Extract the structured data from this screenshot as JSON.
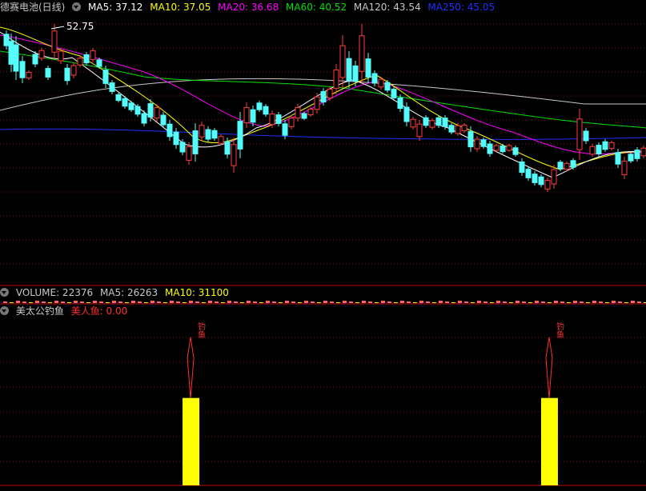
{
  "colors": {
    "bg": "#000000",
    "up": "#ff3c3c",
    "down": "#54fcfc",
    "ma5": "#ffffff",
    "ma10": "#ffff00",
    "ma20": "#ff00ff",
    "ma60": "#00e000",
    "ma120": "#c8c8c8",
    "ma250": "#2030ff",
    "grid": "#7a1010",
    "sep": "#c00000",
    "signal_bar": "#ffff00",
    "signal_text": "#ff3030",
    "vol_up": "#ff6060",
    "vol_bar": "#ffff00"
  },
  "price_panel": {
    "title": "德赛电池(日线)",
    "ma_labels": [
      {
        "label": "MA5: 37.12",
        "color": "#ffffff"
      },
      {
        "label": "MA10: 37.05",
        "color": "#ffff00"
      },
      {
        "label": "MA20: 36.68",
        "color": "#ff00ff"
      },
      {
        "label": "MA60: 40.52",
        "color": "#00e000"
      },
      {
        "label": "MA120: 43.54",
        "color": "#c8c8c8"
      },
      {
        "label": "MA250: 45.05",
        "color": "#2030ff"
      }
    ],
    "high_marker": "52.75"
  },
  "volume_panel": {
    "labels": [
      {
        "label": "VOLUME: 22376",
        "color": "#c8c8c8"
      },
      {
        "label": "MA5: 26263",
        "color": "#c8c8c8"
      },
      {
        "label": "MA10: 31100",
        "color": "#ffff00"
      }
    ]
  },
  "indicator_panel": {
    "title": "美太公钓鱼",
    "series_label": "美人鱼: 0.00",
    "signal_text": "钓鱼"
  },
  "chart_data": [
    {
      "type": "candlestick",
      "title": "德赛电池(日线)",
      "series": [
        {
          "name": "MA5",
          "value": 37.12
        },
        {
          "name": "MA10",
          "value": 37.05
        },
        {
          "name": "MA20",
          "value": 36.68
        },
        {
          "name": "MA60",
          "value": 40.52
        },
        {
          "name": "MA120",
          "value": 43.54
        },
        {
          "name": "MA250",
          "value": 45.05
        }
      ],
      "annotations": [
        {
          "text": "52.75",
          "value": 52.75
        }
      ],
      "ylim": [
        29,
        54
      ]
    },
    {
      "type": "bar",
      "title": "VOLUME",
      "series": [
        {
          "name": "VOLUME",
          "value": 22376
        },
        {
          "name": "MA5",
          "value": 26263
        },
        {
          "name": "MA10",
          "value": 31100
        }
      ]
    },
    {
      "type": "bar",
      "title": "美太公钓鱼",
      "series": [
        {
          "name": "美人鱼",
          "value": 0.0
        }
      ],
      "signals": [
        {
          "index": 0.295,
          "value": 1
        },
        {
          "index": 0.85,
          "value": 1
        }
      ],
      "ylim": [
        0,
        1.1
      ]
    }
  ]
}
